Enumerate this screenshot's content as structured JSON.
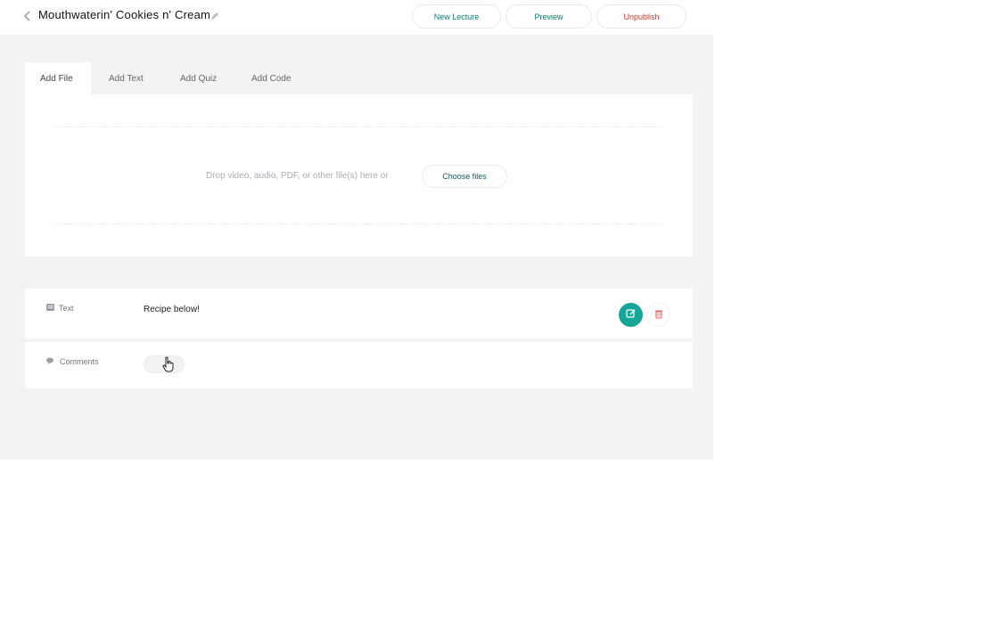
{
  "header": {
    "title": "Mouthwaterin' Cookies n' Cream",
    "buttons": {
      "new_lecture": "New Lecture",
      "preview": "Preview",
      "unpublish": "Unpublish"
    },
    "icons": {
      "back": "chevron-left-icon",
      "edit_title": "pencil-icon"
    }
  },
  "tabs": [
    {
      "label": "Add File",
      "active": true
    },
    {
      "label": "Add Text",
      "active": false
    },
    {
      "label": "Add Quiz",
      "active": false
    },
    {
      "label": "Add Code",
      "active": false
    }
  ],
  "upload": {
    "drop_text": "Drop video, audio, PDF, or other file(s) here or",
    "choose_label": "Choose files"
  },
  "rows": {
    "text": {
      "label": "Text",
      "value": "Recipe below!",
      "icon": "text-block-icon"
    },
    "comments": {
      "label": "Comments",
      "icon": "comments-icon"
    }
  },
  "colors": {
    "accent": "#17a598",
    "accent_text": "#0d7a72",
    "danger": "#c0392b",
    "workspace_bg": "#f3f3f4"
  }
}
